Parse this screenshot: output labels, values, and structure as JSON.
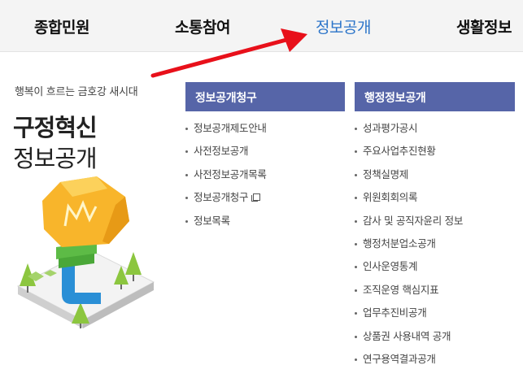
{
  "nav": {
    "items": [
      {
        "label": "종합민원"
      },
      {
        "label": "소통참여"
      },
      {
        "label": "정보공개"
      },
      {
        "label": "생활정보"
      }
    ]
  },
  "colors": {
    "active_nav": "#2b74c9",
    "column_header": "#5665a8",
    "arrow": "#e8101a"
  },
  "promo": {
    "subtitle": "행복이 흐르는 금호강 새시대",
    "title_line1": "구정혁신",
    "title_line2": "정보공개"
  },
  "columns": [
    {
      "header": "정보공개청구",
      "items": [
        {
          "label": "정보공개제도안내"
        },
        {
          "label": "사전정보공개"
        },
        {
          "label": "사전정보공개목록"
        },
        {
          "label": "정보공개청구",
          "icon": "new-window-icon"
        },
        {
          "label": "정보목록"
        }
      ]
    },
    {
      "header": "행정정보공개",
      "items": [
        {
          "label": "성과평가공시"
        },
        {
          "label": "주요사업추진현황"
        },
        {
          "label": "정책실명제"
        },
        {
          "label": "위원회회의록"
        },
        {
          "label": "감사 및 공직자윤리 정보"
        },
        {
          "label": "행정처분업소공개"
        },
        {
          "label": "인사운영통계"
        },
        {
          "label": "조직운영 핵심지표"
        },
        {
          "label": "업무추진비공개"
        },
        {
          "label": "상품권 사용내역 공개"
        },
        {
          "label": "연구용역결과공개"
        }
      ]
    }
  ]
}
